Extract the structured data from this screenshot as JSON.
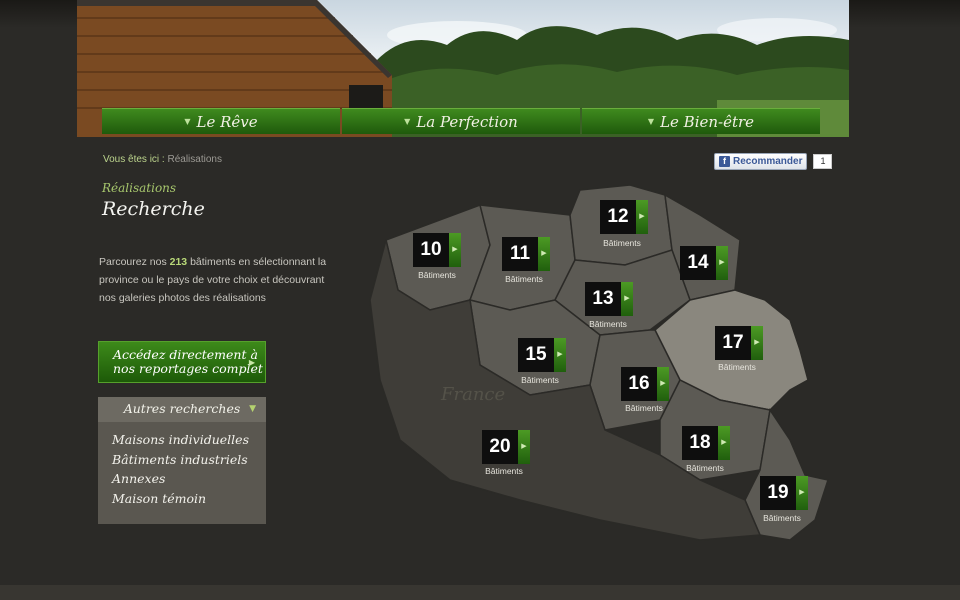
{
  "nav": {
    "items": [
      {
        "label": "Le Rêve"
      },
      {
        "label": "La Perfection"
      },
      {
        "label": "Le Bien-être"
      }
    ]
  },
  "breadcrumb": {
    "prefix": "Vous êtes ici :",
    "current": "Réalisations"
  },
  "facebook": {
    "label": "Recommander",
    "count": "1"
  },
  "page": {
    "subtitle": "Réalisations",
    "title": "Recherche"
  },
  "intro": {
    "part1": "Parcourez nos ",
    "count": "213",
    "part2": " bâtiments en sélectionnant la province ou le pays de votre choix et découvrant nos galeries photos des réalisations"
  },
  "cta": {
    "line1": "Accédez directement à",
    "line2": "nos reportages complet"
  },
  "other_searches": {
    "title": "Autres recherches",
    "items": [
      "Maisons individuelles",
      "Bâtiments industriels",
      "Annexes",
      "Maison témoin"
    ]
  },
  "map": {
    "country_label": "France",
    "marker_caption": "Bâtiments",
    "markers": [
      {
        "num": "10"
      },
      {
        "num": "11"
      },
      {
        "num": "12"
      },
      {
        "num": "13"
      },
      {
        "num": "14"
      },
      {
        "num": "15"
      },
      {
        "num": "16"
      },
      {
        "num": "17"
      },
      {
        "num": "18"
      },
      {
        "num": "19"
      },
      {
        "num": "20"
      }
    ]
  },
  "colors": {
    "accent_green": "#2f7414",
    "label_green": "#a7c76d",
    "background": "#2b2a27"
  }
}
